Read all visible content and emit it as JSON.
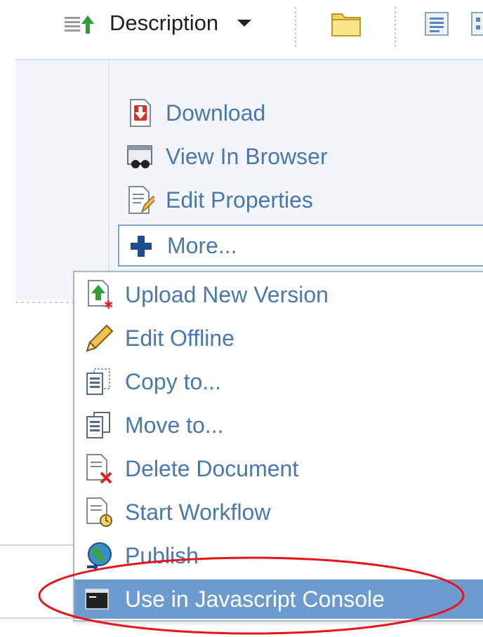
{
  "toolbar": {
    "sort_label": "Description",
    "icons": [
      "sort-ascending-icon",
      "caret-down-icon",
      "folder-icon",
      "detailed-view-icon",
      "simple-view-icon"
    ]
  },
  "document_actions": [
    {
      "label": "Download",
      "icon": "download-icon"
    },
    {
      "label": "View In Browser",
      "icon": "view-in-browser-icon"
    },
    {
      "label": "Edit Properties",
      "icon": "edit-properties-icon"
    }
  ],
  "more": {
    "label": "More...",
    "icon": "plus-icon"
  },
  "more_menu": {
    "items": [
      {
        "label": "Upload New Version",
        "icon": "upload-new-version-icon"
      },
      {
        "label": "Edit Offline",
        "icon": "pencil-icon"
      },
      {
        "label": "Copy to...",
        "icon": "copy-icon"
      },
      {
        "label": "Move to...",
        "icon": "move-icon"
      },
      {
        "label": "Delete Document",
        "icon": "delete-document-icon"
      },
      {
        "label": "Start Workflow",
        "icon": "start-workflow-icon"
      },
      {
        "label": "Publish",
        "icon": "publish-icon"
      },
      {
        "label": "Use in Javascript Console",
        "icon": "console-icon",
        "highlighted": true
      }
    ]
  },
  "colors": {
    "link": "#4a78ad",
    "highlight": "#6d9bcf",
    "annotation": "#e8141c"
  }
}
